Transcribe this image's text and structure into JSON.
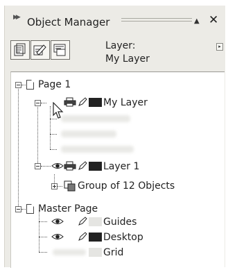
{
  "panel": {
    "title": "Object Manager",
    "layer_caption": "Layer:",
    "active_layer": "My Layer"
  },
  "tree": {
    "page1": {
      "label": "Page 1"
    },
    "my_layer": {
      "label": "My Layer"
    },
    "layer1": {
      "label": "Layer 1"
    },
    "group": {
      "label": "Group of 12 Objects"
    },
    "master_page": {
      "label": "Master Page"
    },
    "guides": {
      "label": "Guides"
    },
    "desktop": {
      "label": "Desktop"
    },
    "grid": {
      "label": "Grid"
    }
  },
  "icons": {
    "collapse": "double-triangle-icon",
    "scroll_up": "triangle-up-icon",
    "close": "close-icon",
    "toolbar": [
      "show-object-properties-icon",
      "edit-across-layers-icon",
      "layer-manager-view-icon"
    ],
    "page": "page-icon",
    "eye": "eye-icon",
    "printer": "printer-icon",
    "pencil": "pencil-icon",
    "group": "group-icon",
    "flyout": "flyout-arrow-icon",
    "cursor": "mouse-pointer-icon"
  },
  "colors": {
    "panel_bg": "#ecebe6",
    "tree_bg": "#ffffff",
    "swatch_dark": "#222222",
    "swatch_light": "#e5e5e2"
  }
}
